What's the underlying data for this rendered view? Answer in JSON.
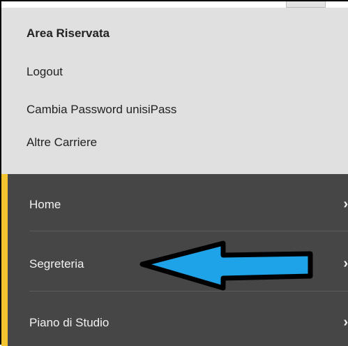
{
  "user_menu": {
    "title": "Area Riservata",
    "links": [
      {
        "label": "Logout"
      },
      {
        "label": "Cambia Password unisiPass"
      },
      {
        "label": "Altre Carriere"
      }
    ]
  },
  "nav": {
    "items": [
      {
        "label": "Home",
        "chevron": "›"
      },
      {
        "label": "Segreteria",
        "chevron": "›"
      },
      {
        "label": "Piano di Studio",
        "chevron": "›"
      }
    ]
  },
  "colors": {
    "user_panel_bg": "#e0e0e0",
    "nav_bg": "#474646",
    "nav_accent": "#f4c430",
    "arrow_fill": "#1ea3e8"
  },
  "annotation": {
    "icon": "left-pointing-arrow-icon"
  }
}
